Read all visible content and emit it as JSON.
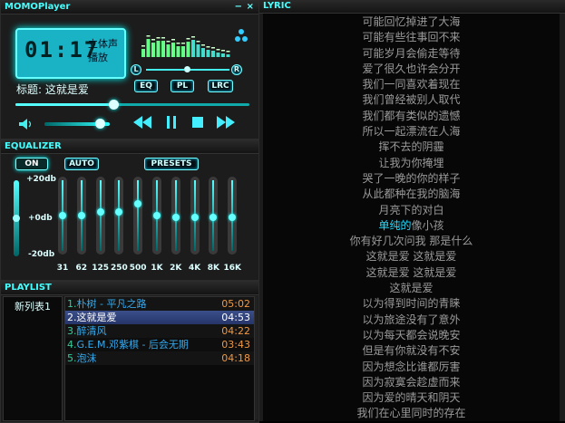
{
  "player": {
    "title": "MOMOPlayer",
    "minimize": "−",
    "close": "×",
    "time": "01:17",
    "mode_line1": "立体声",
    "mode_line2": "播放",
    "track_label": "标题: 这就是爱",
    "balance_left": "L",
    "balance_right": "R",
    "btn_eq": "EQ",
    "btn_pl": "PL",
    "btn_lrc": "LRC",
    "seek_progress": 0.42,
    "volume_level": 0.85,
    "spectrum": [
      0.35,
      0.75,
      0.62,
      0.68,
      0.7,
      0.55,
      0.6,
      0.45,
      0.48,
      0.65,
      0.72,
      0.55,
      0.4,
      0.3,
      0.28,
      0.2,
      0.15,
      0.1
    ]
  },
  "equalizer": {
    "title": "EQUALIZER",
    "btn_on": "ON",
    "btn_auto": "AUTO",
    "btn_presets": "PRESETS",
    "db_top": "+20db",
    "db_mid": "+0db",
    "db_bottom": "-20db",
    "preamp": 0.5,
    "bands": [
      {
        "label": "31",
        "level": 0.5
      },
      {
        "label": "62",
        "level": 0.5
      },
      {
        "label": "125",
        "level": 0.45
      },
      {
        "label": "250",
        "level": 0.45
      },
      {
        "label": "500",
        "level": 0.35
      },
      {
        "label": "1K",
        "level": 0.5
      },
      {
        "label": "2K",
        "level": 0.52
      },
      {
        "label": "4K",
        "level": 0.52
      },
      {
        "label": "8K",
        "level": 0.52
      },
      {
        "label": "16K",
        "level": 0.52
      }
    ]
  },
  "playlist": {
    "title": "PLAYLIST",
    "lists": [
      "新列表1"
    ],
    "items": [
      {
        "num": "1.",
        "name": "朴树 - 平凡之路",
        "time": "05:02",
        "active": false
      },
      {
        "num": "2.",
        "name": "这就是爱",
        "time": "04:53",
        "active": true
      },
      {
        "num": "3.",
        "name": "醉清风",
        "time": "04:22",
        "active": false
      },
      {
        "num": "4.",
        "name": "G.E.M.邓紫棋 - 后会无期",
        "time": "03:43",
        "active": false
      },
      {
        "num": "5.",
        "name": "泡沫",
        "time": "04:18",
        "active": false
      }
    ]
  },
  "lyric": {
    "title": "LYRIC",
    "lines": [
      "可能回忆掉进了大海",
      "可能有些往事回不来",
      "可能岁月会偷走等待",
      "爱了很久也许会分开",
      "我们一同喜欢着现在",
      "我们曾经被别人取代",
      "我们都有类似的遗憾",
      "所以一起漂流在人海",
      "挥不去的阴霾",
      "让我为你掩埋",
      "哭了一晚的你的样子",
      "从此都种在我的脑海",
      "月亮下的对白",
      "单纯的像小孩",
      "你有好几次问我 那是什么",
      "这就是爱 这就是爱",
      "这就是爱 这就是爱",
      "这就是爱",
      "以为得到时间的青睐",
      "以为旅途没有了意外",
      "以为每天都会说晚安",
      "但是有你就没有不安",
      "因为想念比谁都厉害",
      "因为寂寞会趁虚而来",
      "因为爱的晴天和阴天",
      "我们在心里同时的存在"
    ],
    "highlight_index": 13,
    "highlight_chars": 3
  }
}
